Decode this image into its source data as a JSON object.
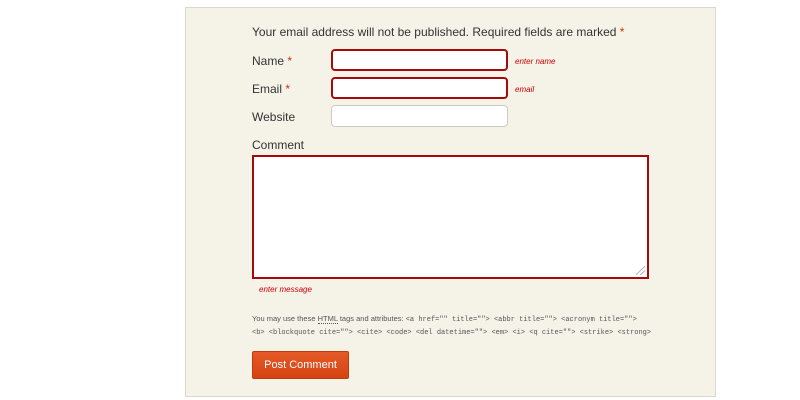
{
  "form": {
    "notice": "Your email address will not be published. Required fields are marked",
    "required_mark": "*",
    "name_label": "Name",
    "email_label": "Email",
    "website_label": "Website",
    "comment_label": "Comment",
    "name_value": "",
    "email_value": "",
    "website_value": "",
    "comment_value": "",
    "name_error": "enter name",
    "email_error": "email",
    "comment_error": "enter message",
    "allowed_tags_prefix": "You may use these",
    "allowed_tags_abbr": "HTML",
    "allowed_tags_middle": "tags and attributes:",
    "allowed_tags_code": "<a href=\"\" title=\"\"> <abbr title=\"\"> <acronym title=\"\"> <b> <blockquote cite=\"\"> <cite> <code> <del datetime=\"\"> <em> <i> <q cite=\"\"> <strike> <strong>",
    "submit_label": "Post Comment"
  },
  "colors": {
    "panel_bg": "#f5f2e8",
    "error_border": "#a40a0a",
    "error_text": "#cc0000",
    "button_bg": "#e0501c"
  }
}
